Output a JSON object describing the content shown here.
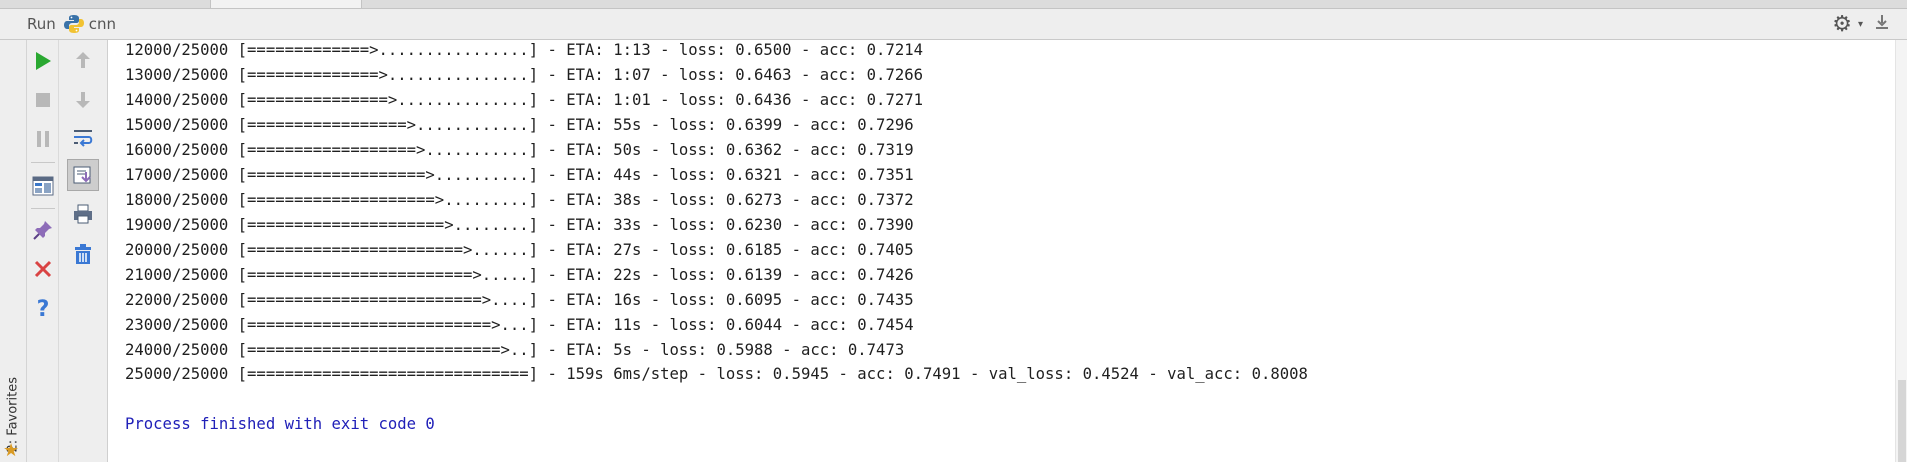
{
  "header": {
    "run_label": "Run",
    "config_name": "cnn",
    "settings_icon": "gear-icon",
    "hide_icon": "hide-panel-icon"
  },
  "favorites": {
    "label": "2: Favorites",
    "icon": "star-icon"
  },
  "toolbar_left": [
    {
      "name": "rerun-button",
      "icon": "play-icon",
      "color": "#2aa831",
      "enabled": true
    },
    {
      "name": "stop-button",
      "icon": "stop-icon",
      "color": "#b4b4b4",
      "enabled": false
    },
    {
      "name": "pause-button",
      "icon": "pause-icon",
      "color": "#b4b4b4",
      "enabled": false
    },
    {
      "name": "restore-layout-button",
      "icon": "layout-icon",
      "enabled": true
    },
    {
      "name": "pin-tab-button",
      "icon": "pin-icon",
      "enabled": true
    },
    {
      "name": "close-button",
      "icon": "close-icon",
      "color": "#d94343",
      "enabled": true
    },
    {
      "name": "help-button",
      "icon": "help-icon",
      "color": "#3a78d4",
      "enabled": true
    }
  ],
  "toolbar_right": [
    {
      "name": "up-stack-button",
      "icon": "arrow-up-icon",
      "enabled": false
    },
    {
      "name": "down-stack-button",
      "icon": "arrow-down-icon",
      "enabled": false
    },
    {
      "name": "soft-wrap-button",
      "icon": "soft-wrap-icon",
      "enabled": true
    },
    {
      "name": "scroll-to-end-button",
      "icon": "scroll-to-end-icon",
      "enabled": true,
      "active": true
    },
    {
      "name": "print-button",
      "icon": "print-icon",
      "enabled": true
    },
    {
      "name": "clear-all-button",
      "icon": "trash-icon",
      "enabled": true
    }
  ],
  "console": {
    "lines": [
      "12000/25000 [=============>................] - ETA: 1:13 - loss: 0.6500 - acc: 0.7214",
      "13000/25000 [==============>...............] - ETA: 1:07 - loss: 0.6463 - acc: 0.7266",
      "14000/25000 [===============>..............] - ETA: 1:01 - loss: 0.6436 - acc: 0.7271",
      "15000/25000 [=================>............] - ETA: 55s - loss: 0.6399 - acc: 0.7296",
      "16000/25000 [==================>...........] - ETA: 50s - loss: 0.6362 - acc: 0.7319",
      "17000/25000 [===================>..........] - ETA: 44s - loss: 0.6321 - acc: 0.7351",
      "18000/25000 [====================>.........] - ETA: 38s - loss: 0.6273 - acc: 0.7372",
      "19000/25000 [=====================>........] - ETA: 33s - loss: 0.6230 - acc: 0.7390",
      "20000/25000 [=======================>......] - ETA: 27s - loss: 0.6185 - acc: 0.7405",
      "21000/25000 [========================>.....] - ETA: 22s - loss: 0.6139 - acc: 0.7426",
      "22000/25000 [=========================>....] - ETA: 16s - loss: 0.6095 - acc: 0.7435",
      "23000/25000 [==========================>...] - ETA: 11s - loss: 0.6044 - acc: 0.7454",
      "24000/25000 [===========================>..] - ETA: 5s - loss: 0.5988 - acc: 0.7473",
      "25000/25000 [==============================] - 159s 6ms/step - loss: 0.5945 - acc: 0.7491 - val_loss: 0.4524 - val_acc: 0.8008",
      "",
      "Process finished with exit code 0"
    ],
    "text_color": "#1f1f1f",
    "finished_color": "#2020b8"
  }
}
